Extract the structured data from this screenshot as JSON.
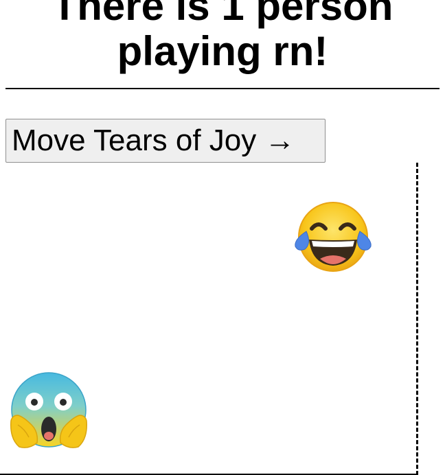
{
  "page": {
    "heading": "There is 1 person playing rn!"
  },
  "controls": {
    "move_button_label": "Move Tears of Joy →"
  },
  "arena": {
    "players": [
      {
        "name": "Tears of Joy",
        "icon": "face-with-tears-of-joy-icon"
      },
      {
        "name": "Screaming in Fear",
        "icon": "face-screaming-in-fear-icon"
      }
    ]
  },
  "colors": {
    "joy_face": "#f8c51a",
    "tears": "#4e86e6",
    "scream_top": "#47b9e0",
    "scream_bottom": "#f9d423",
    "hands": "#f5c518"
  }
}
